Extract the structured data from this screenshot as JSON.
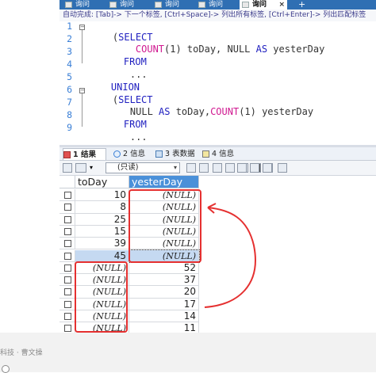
{
  "tabs": [
    {
      "label": "询问"
    },
    {
      "label": "询问"
    },
    {
      "label": "询问"
    },
    {
      "label": "询问"
    },
    {
      "label": "询问",
      "close": "×"
    }
  ],
  "tab_add": "+",
  "hint": "自动完成:   [Tab]-> 下一个标签,   [Ctrl+Space]-> 列出所有标签,   [Ctrl+Enter]-> 列出匹配标签",
  "editor": {
    "line_numbers": [
      "1",
      "2",
      "3",
      "4",
      "5",
      "6",
      "7",
      "8",
      "9"
    ],
    "lines": [
      {
        "parts": [
          {
            "t": "(",
            "c": ""
          },
          {
            "t": "SELECT",
            "c": "kw"
          }
        ]
      },
      {
        "parts": [
          {
            "t": "COUNT",
            "c": "fn"
          },
          {
            "t": "(1) toDay, NULL ",
            "c": ""
          },
          {
            "t": "AS",
            "c": "kw"
          },
          {
            "t": " yesterDay",
            "c": ""
          }
        ]
      },
      {
        "parts": [
          {
            "t": "FROM",
            "c": "kw"
          }
        ]
      },
      {
        "parts": [
          {
            "t": "...",
            "c": ""
          }
        ]
      },
      {
        "parts": [
          {
            "t": "UNION",
            "c": "kw"
          }
        ]
      },
      {
        "parts": [
          {
            "t": "(",
            "c": ""
          },
          {
            "t": "SELECT",
            "c": "kw"
          }
        ]
      },
      {
        "parts": [
          {
            "t": "NULL ",
            "c": ""
          },
          {
            "t": "AS",
            "c": "kw"
          },
          {
            "t": " toDay,",
            "c": ""
          },
          {
            "t": "COUNT",
            "c": "fn"
          },
          {
            "t": "(1) yesterDay",
            "c": ""
          }
        ]
      },
      {
        "parts": [
          {
            "t": "FROM",
            "c": "kw"
          }
        ]
      },
      {
        "parts": [
          {
            "t": "...",
            "c": ""
          }
        ]
      }
    ]
  },
  "result_tabs": [
    {
      "num": "1",
      "label": "结果"
    },
    {
      "num": "2",
      "label": "信息"
    },
    {
      "num": "3",
      "label": "表数据"
    },
    {
      "num": "4",
      "label": "信息"
    }
  ],
  "toolbar": {
    "readonly_label": "(只读)",
    "caret": "▾"
  },
  "grid": {
    "columns": [
      "toDay",
      "yesterDay"
    ],
    "rows": [
      [
        "10",
        "(NULL)"
      ],
      [
        "8",
        "(NULL)"
      ],
      [
        "25",
        "(NULL)"
      ],
      [
        "15",
        "(NULL)"
      ],
      [
        "39",
        "(NULL)"
      ],
      [
        "45",
        "(NULL)"
      ],
      [
        "(NULL)",
        "52"
      ],
      [
        "(NULL)",
        "37"
      ],
      [
        "(NULL)",
        "20"
      ],
      [
        "(NULL)",
        "17"
      ],
      [
        "(NULL)",
        "14"
      ],
      [
        "(NULL)",
        "11"
      ]
    ],
    "selected_row": 5
  },
  "credit": "科技 · 曹文操",
  "colors": {
    "tabbar": "#2f6fb3",
    "keyword": "#2020c0",
    "function": "#d01890",
    "line_number": "#3a7fd6",
    "header_selected": "#4a90d9",
    "row_selected": "#c5d9f1",
    "annotation": "#e53030"
  }
}
